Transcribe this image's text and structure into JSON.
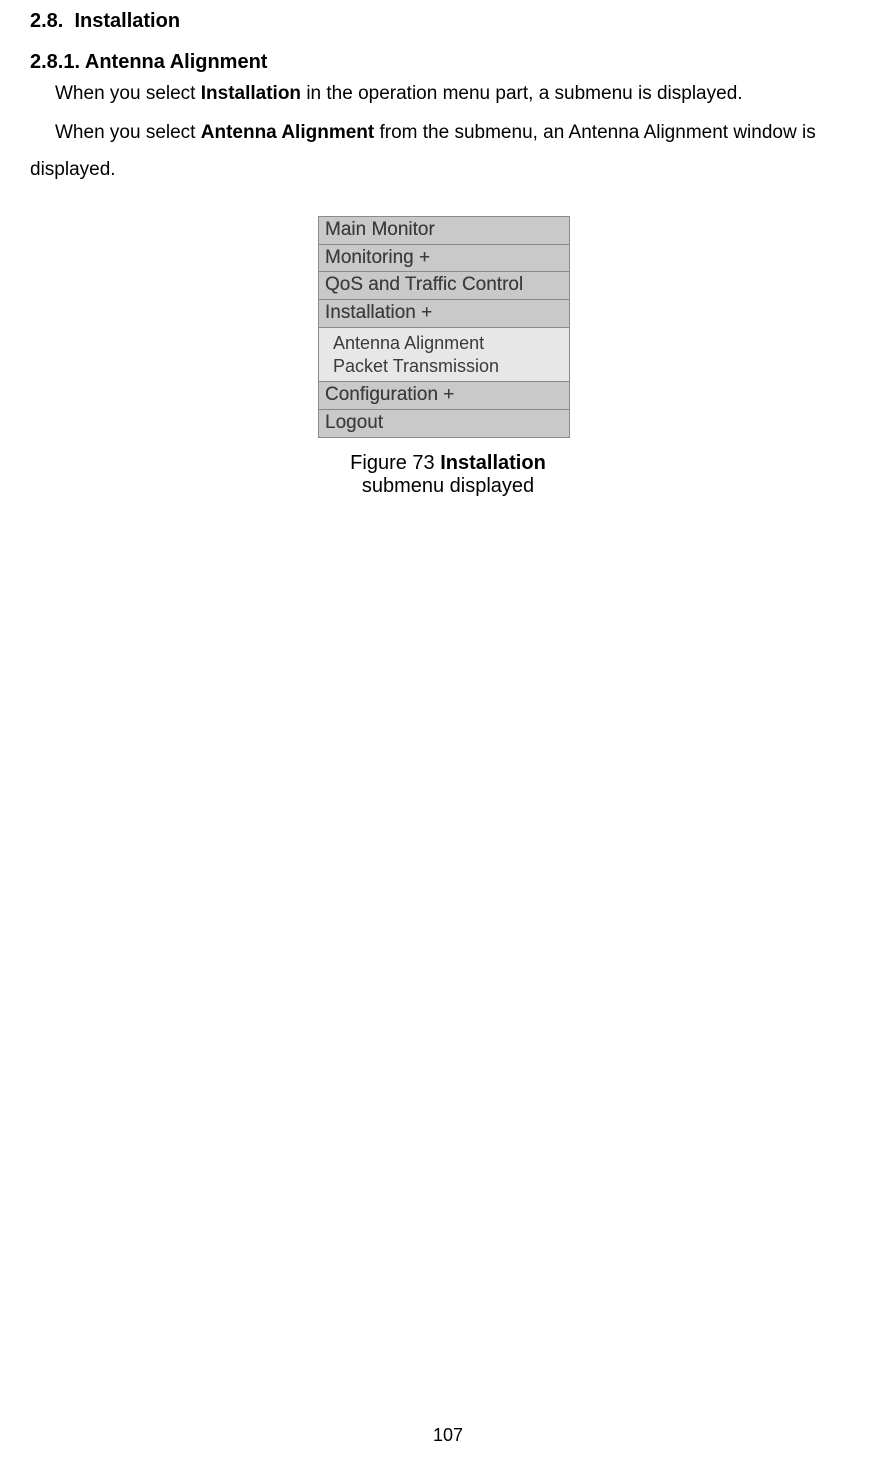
{
  "section": {
    "number": "2.8.",
    "title": "Installation"
  },
  "subsection": {
    "number": "2.8.1.",
    "title": "Antenna Alignment"
  },
  "paragraph1": {
    "pre": "When you select ",
    "bold": "Installation",
    "post": " in the operation menu part, a submenu is displayed."
  },
  "paragraph2": {
    "pre": "When you select ",
    "bold": "Antenna Alignment",
    "post1": " from the submenu, an Antenna Alignment window is",
    "post2": "displayed."
  },
  "menu": {
    "items": [
      "Main Monitor",
      "Monitoring +",
      "QoS and Traffic Control",
      "Installation +"
    ],
    "submenu_lines": [
      "Antenna Alignment",
      "Packet Transmission"
    ],
    "items_after": [
      "Configuration +",
      "Logout"
    ]
  },
  "caption": {
    "pre": "Figure 73 ",
    "bold": "Installation",
    "post": " submenu displayed"
  },
  "page_number": "107"
}
